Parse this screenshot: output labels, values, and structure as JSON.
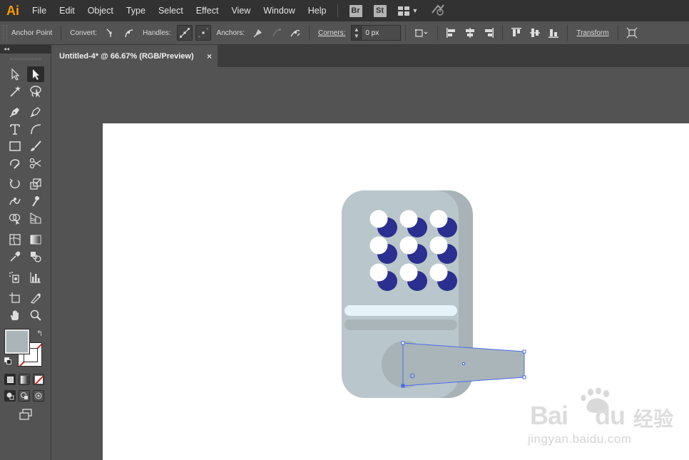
{
  "app": {
    "logo": "Ai"
  },
  "menu": {
    "items": [
      "File",
      "Edit",
      "Object",
      "Type",
      "Select",
      "Effect",
      "View",
      "Window",
      "Help"
    ],
    "bridge_icon": "Br",
    "stock_icon": "St",
    "workspace_icon": "workspace-switcher-icon",
    "gpu_icon": "gpu-performance-icon"
  },
  "control": {
    "tool_name": "Anchor Point",
    "convert_label": "Convert:",
    "handles_label": "Handles:",
    "anchors_label": "Anchors:",
    "corners_label": "Corners:",
    "corners_value": "0 px",
    "transform_label": "Transform"
  },
  "document": {
    "tab_title": "Untitled-4* @ 66.67% (RGB/Preview)",
    "close_glyph": "×"
  },
  "toolbox": {
    "collapse_glyph": "◂◂",
    "fill_color": "#a9b5b9",
    "stroke_color": "none"
  },
  "artwork": {
    "body_color": "#b9c6cb",
    "shadow_color": "#a7b3b7",
    "key_white": "#ffffff",
    "key_blue": "#2b2f8f",
    "light_bar_color": "#e6f4fa",
    "dark_bar_color": "#a9b5b9",
    "handle_color": "#a9b5b9",
    "selection_color": "#4a6cf0"
  },
  "watermark": {
    "brand": "Bai",
    "brand_tail": "du",
    "chinese": "经验",
    "url": "jingyan.baidu.com"
  }
}
